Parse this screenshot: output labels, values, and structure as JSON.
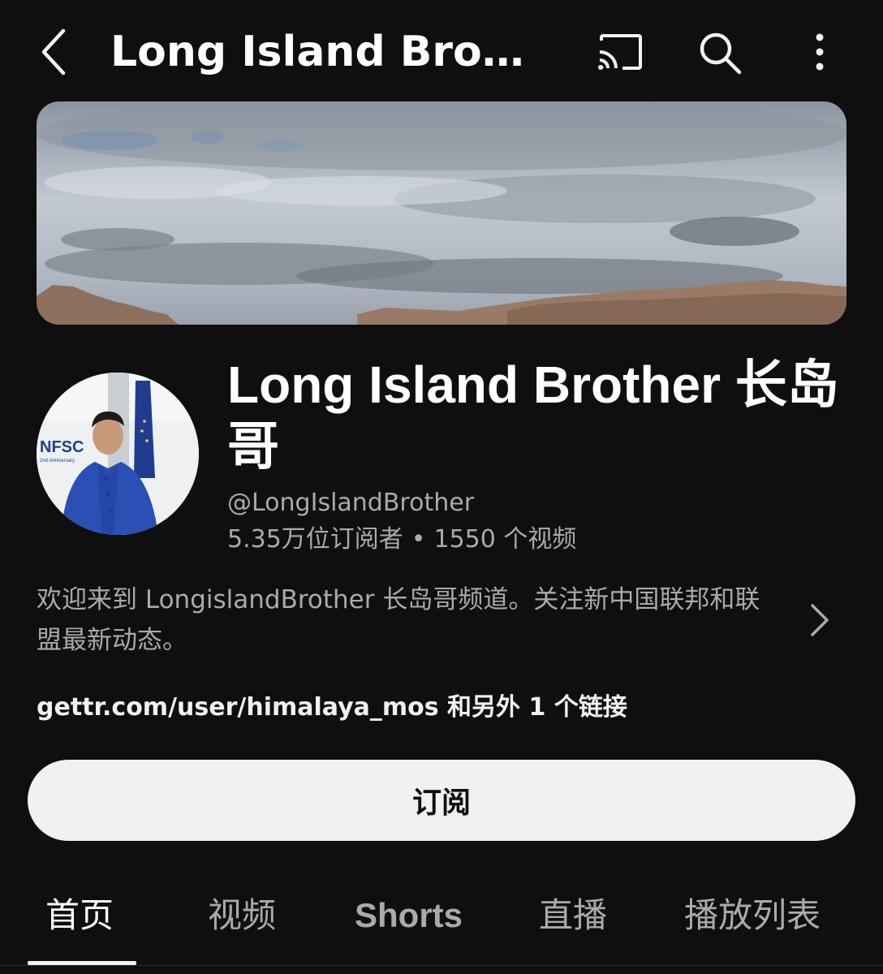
{
  "header": {
    "title": "Long Island Broth...",
    "icons": [
      "back-arrow-icon",
      "cast-icon",
      "search-icon",
      "more-vert-icon"
    ]
  },
  "banner": {
    "description_icon": "banner-image"
  },
  "channel": {
    "name": "Long Island Brother 长岛哥",
    "handle": "@LongIslandBrother",
    "subscribers": "5.35万位订阅者",
    "separator": "•",
    "videos": "1550 个视频",
    "avatar": {
      "sign_text": "NFSC",
      "sign_subtext": "2nd Anniversary"
    },
    "description": "欢迎来到 LongislandBrother 长岛哥频道。关注新中国联邦和联盟最新动态。",
    "links": "gettr.com/user/himalaya_mos 和另外 1 个链接"
  },
  "subscribe": {
    "label": "订阅"
  },
  "tabs": [
    {
      "label": "首页",
      "active": true
    },
    {
      "label": "视频",
      "active": false
    },
    {
      "label": "Shorts",
      "active": false
    },
    {
      "label": "直播",
      "active": false
    },
    {
      "label": "播放列表",
      "active": false
    }
  ],
  "colors": {
    "background": "#0f0f0f",
    "primary_text": "#f1f1f1",
    "secondary_text": "#aaaaaa",
    "subscribe_bg": "#f1f1f1"
  }
}
